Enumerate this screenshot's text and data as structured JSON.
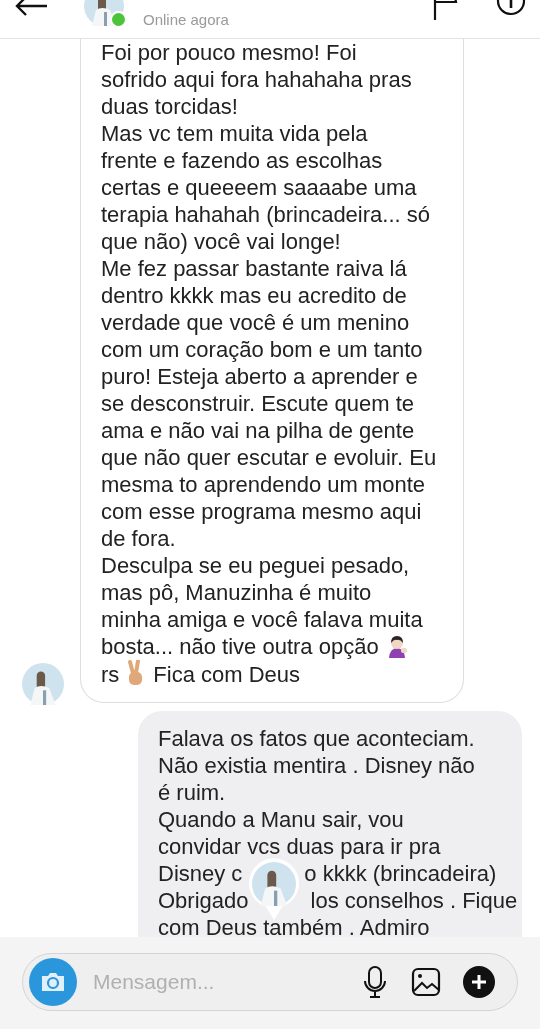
{
  "header": {
    "status": "Online agora",
    "online": true
  },
  "received": {
    "lines": [
      [
        "Foi por pouco mesmo! Foi"
      ],
      [
        "sofrido aqui fora hahahaha pras"
      ],
      [
        "duas torcidas!"
      ],
      [
        "Mas vc tem muita vida pela"
      ],
      [
        "frente e fazendo as escolhas"
      ],
      [
        "certas e queeeem saaaabe uma"
      ],
      [
        "terapia hahahah (brincadeira... só"
      ],
      [
        "que não) você vai longe!"
      ],
      [
        "Me fez passar bastante raiva lá"
      ],
      [
        "dentro kkkk mas eu acredito de"
      ],
      [
        "verdade que você é um menino"
      ],
      [
        "com um coração bom e um tanto"
      ],
      [
        "puro! Esteja aberto a aprender e"
      ],
      [
        "se desconstruir. Escute quem te"
      ],
      [
        "ama e não vai na pilha de gente"
      ],
      [
        "que não quer escutar e evoluir. Eu"
      ],
      [
        "mesma to aprendendo um monte"
      ],
      [
        "com esse programa mesmo aqui"
      ],
      [
        "de fora."
      ],
      [
        "Desculpa se eu peguei pesado,"
      ],
      [
        "mas pô, Manuzinha é muito"
      ],
      [
        "minha amiga e você falava muita"
      ],
      [
        "bosta... não tive outra opção",
        {
          "kind": "shrug"
        }
      ],
      [
        "rs",
        {
          "kind": "peace"
        },
        "Fica com Deus"
      ]
    ]
  },
  "sent": {
    "lines": [
      [
        "Falava os fatos que aconteciam."
      ],
      [
        "Não existia mentira .  Disney não"
      ],
      [
        "é ruim."
      ],
      [
        "Quando a Manu sair, vou"
      ],
      [
        "convidar vcs duas para ir pra"
      ],
      [
        "Disney c",
        {
          "kind": "gap"
        },
        "o kkkk (brincadeira)"
      ],
      [
        "Obrigado",
        {
          "kind": "gap"
        },
        "los conselhos . Fique"
      ],
      [
        "com Deus também . Admiro"
      ]
    ]
  },
  "composer": {
    "placeholder": "Mensagem..."
  }
}
